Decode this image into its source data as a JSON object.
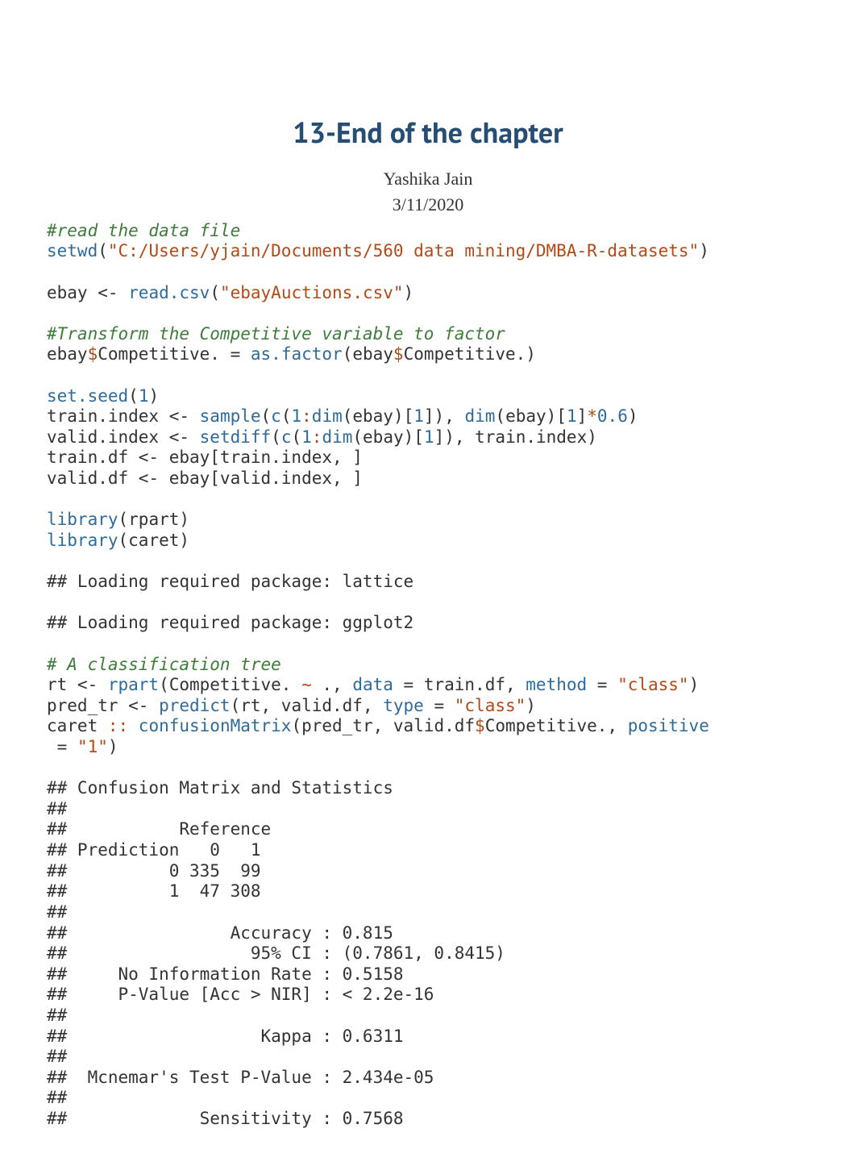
{
  "title": "13-End of the chapter",
  "author": "Yashika Jain",
  "date": "3/11/2020",
  "code": {
    "c1": "#read the data file",
    "setwd": "setwd",
    "lp": "(",
    "rp": ")",
    "path": "\"C:/Users/yjain/Documents/560 data mining/DMBA-R-datasets\"",
    "ebay_assign": "ebay <- ",
    "readcsv": "read.csv",
    "csvfile": "\"ebayAuctions.csv\"",
    "c2": "#Transform the Competitive variable to factor",
    "ebay": "ebay",
    "dollar": "$",
    "competitive_eq": "Competitive. = ",
    "asfactor": "as.factor",
    "ebay_comp_inner": "Competitive.)",
    "setseed": "set.seed",
    "one": "1",
    "train_idx_lhs": "train.index <- ",
    "sample": "sample",
    "cfn": "c",
    "colon": ":",
    "dim": "dim",
    "ebay_in": "(ebay)[",
    "close_br": "]), ",
    "close_br2": "]",
    "star": "*",
    "p06": "0.6",
    "valid_idx_lhs": "valid.index <- ",
    "setdiff": "setdiff",
    "trainindex": "]), train.index)",
    "traindf": "train.df <- ebay[train.index, ]",
    "validdf": "valid.df <- ebay[valid.index, ]",
    "library": "library",
    "rpart": "(rpart)",
    "caret": "(caret)",
    "out1": "## Loading required package: lattice",
    "out2": "## Loading required package: ggplot2",
    "c3": "# A classification tree",
    "rt_lhs": "rt <- ",
    "rpartfn": "rpart",
    "rpart_args_a": "(Competitive. ",
    "tilde": "~",
    "rpart_args_b": " ., ",
    "data_kw": "data",
    "eq": " = ",
    "traindf_v": "train.df, ",
    "method_kw": "method",
    "class_str": "\"class\"",
    "pred_lhs": "pred_tr <- ",
    "predict": "predict",
    "predict_args_a": "(rt, valid.df, ",
    "type_kw": "type",
    "caret_ns": "caret ",
    "dcolon": "::",
    "confm": " confusionMatrix",
    "confm_args_a": "(pred_tr, valid.df",
    "confm_args_b": "Competitive., ",
    "positive_kw": "positive",
    "wrap": " = ",
    "one_str": "\"1\"",
    "out3": "## Confusion Matrix and Statistics",
    "out4": "## ",
    "out5": "##           Reference",
    "out6": "## Prediction   0   1",
    "out7": "##          0 335  99",
    "out8": "##          1  47 308",
    "out9": "##                                           ",
    "out10": "##                Accuracy : 0.815           ",
    "out11": "##                  95% CI : (0.7861, 0.8415)",
    "out12": "##     No Information Rate : 0.5158          ",
    "out13": "##     P-Value [Acc > NIR] : < 2.2e-16       ",
    "out14": "##                                           ",
    "out15": "##                   Kappa : 0.6311          ",
    "out16": "##                                           ",
    "out17": "##  Mcnemar's Test P-Value : 2.434e-05       ",
    "out18": "##                                           ",
    "out19": "##             Sensitivity : 0.7568          "
  }
}
